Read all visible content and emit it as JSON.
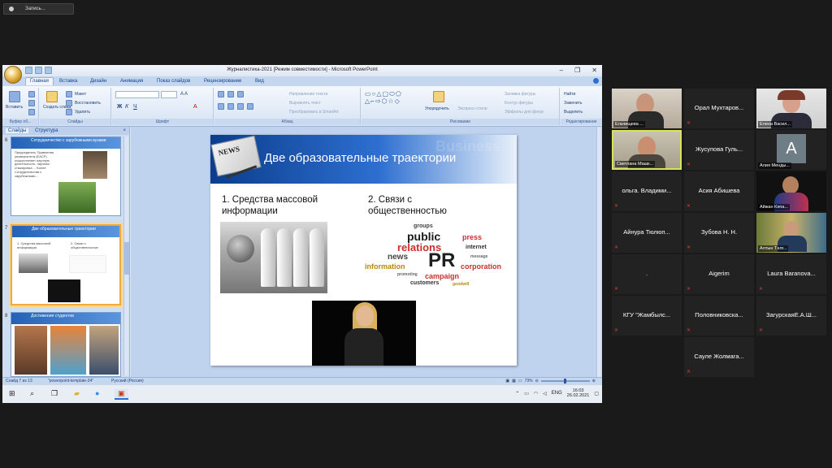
{
  "recording": {
    "label": "Запись..."
  },
  "ppt": {
    "window_title": "Журналистика-2021 [Режим совместимости] - Microsoft PowerPoint",
    "tabs": [
      "Главная",
      "Вставка",
      "Дизайн",
      "Анимация",
      "Показ слайдов",
      "Рецензирование",
      "Вид"
    ],
    "ribbon": {
      "paste": "Вставить",
      "create_slide": "Создать слайд",
      "layout": "Макет",
      "restore": "Восстановить",
      "delete": "Удалить",
      "text_direction": "Направление текста",
      "align_text": "Выровнять текст",
      "smartart": "Преобразовать в SmartArt",
      "arrange": "Упорядочить",
      "express_styles": "Экспресс-стили",
      "shape_fill": "Заливка фигуры",
      "shape_outline": "Контур фигуры",
      "shape_effects": "Эффекты для фигур",
      "find": "Найти",
      "replace": "Заменить",
      "select": "Выделить",
      "groups": {
        "clipboard": "Буфер об...",
        "slides": "Слайды",
        "font": "Шрифт",
        "paragraph": "Абзац",
        "drawing": "Рисование",
        "editing": "Редактирование"
      }
    },
    "panel_tabs": {
      "slides": "Слайды",
      "structure": "Структура",
      "close": "×"
    },
    "thumbnails": [
      {
        "num": "6",
        "title": "Сотрудничество с зарубежными вузами",
        "text": "Председатель Правления университета (ЕАСР) осуществляет научную деятельность, научная стажировка ... Более Сотрудничества с зарубежными..."
      },
      {
        "num": "7",
        "title": "Две образовательные траектории",
        "item1": "1. Средства массовой информации",
        "item2": "2. Связи с общественностью"
      },
      {
        "num": "8",
        "title": "Достижения студентов"
      }
    ],
    "slide": {
      "title": "Две образовательные траектории",
      "news_label": "NEWS",
      "watermark": "Business",
      "item1": "1. Средства массовой информации",
      "item2": "2. Связи с общественностью",
      "wordcloud": [
        "groups",
        "public",
        "relations",
        "press",
        "news",
        "internet",
        "PR",
        "information",
        "promoting",
        "message",
        "corporation",
        "campaign",
        "customers",
        "goodwill"
      ]
    },
    "status": {
      "slide": "Слайд 7 из 13",
      "theme": "\"powerpoint-template-24\"",
      "lang": "Русский (Россия)",
      "zoom": "73%"
    },
    "taskbar": {
      "lang": "ENG",
      "time": "16:03",
      "date": "26.02.2021"
    }
  },
  "participants": [
    {
      "name": "Ельчищева ...",
      "video": true
    },
    {
      "name": "Орал Мухтаров...",
      "video": false
    },
    {
      "name": "Елена Васил...",
      "video": true
    },
    {
      "name": "Светлана Машк...",
      "video": true,
      "highlight": true
    },
    {
      "name": "Жусупова Гуль...",
      "video": false
    },
    {
      "name": "Алия Менды...",
      "video": false,
      "avatar": "A"
    },
    {
      "name": "ольга. Владими...",
      "video": false
    },
    {
      "name": "Асия Абишева",
      "video": false
    },
    {
      "name": "Айжан Кәпа...",
      "video": true
    },
    {
      "name": "Айнура Тюлюп...",
      "video": false
    },
    {
      "name": "Зубова Н. Н.",
      "video": false
    },
    {
      "name": "Алтын Тәлг...",
      "video": true
    },
    {
      "name": ".",
      "video": false
    },
    {
      "name": "Aigerim",
      "video": false
    },
    {
      "name": "Laura Baranova...",
      "video": false
    },
    {
      "name": "КГУ \"Жамбылс...",
      "video": false
    },
    {
      "name": "Половниковска...",
      "video": false
    },
    {
      "name": "ЗагурскаяЕ.А.Ш...",
      "video": false
    },
    {
      "name": "Сауле Жолмага...",
      "video": false
    }
  ],
  "colors": {
    "ribbon_blue": "#15428b",
    "slide_header": "#2d6fd0",
    "mute_red": "#e23b3b",
    "highlight": "#d8e35b"
  }
}
